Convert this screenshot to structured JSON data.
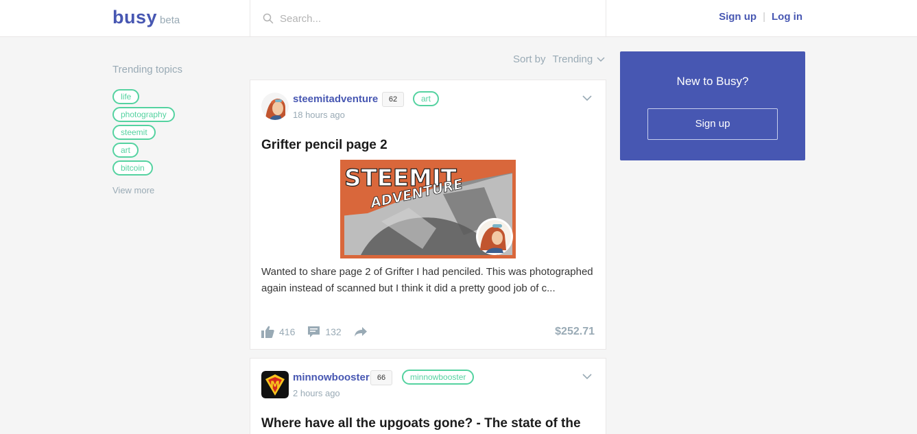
{
  "header": {
    "brand": "busy",
    "brand_tag": "beta",
    "search_placeholder": "Search...",
    "signup": "Sign up",
    "separator": "|",
    "login": "Log in"
  },
  "sidebar": {
    "title": "Trending topics",
    "tags": [
      "life",
      "photography",
      "steemit",
      "art",
      "bitcoin"
    ],
    "view_more": "View more"
  },
  "sort": {
    "label": "Sort by",
    "value": "Trending"
  },
  "posts": [
    {
      "author": "steemitadventure",
      "reputation": "62",
      "tag": "art",
      "time": "18 hours ago",
      "title": "Grifter pencil page 2",
      "excerpt": "Wanted to share page 2 of Grifter I had penciled. This was photographed again instead of scanned but I think it did a pretty good job of c...",
      "cover_text_1": "STEEMIT",
      "cover_text_2": "ADVENTURE",
      "likes": "416",
      "comments": "132",
      "payout": "$252.71"
    },
    {
      "author": "minnowbooster",
      "reputation": "66",
      "tag": "minnowbooster",
      "time": "2 hours ago",
      "title": "Where have all the upgoats gone? - The state of the",
      "avatar_letter": "M"
    }
  ],
  "signup_card": {
    "title": "New to Busy?",
    "button": "Sign up"
  },
  "colors": {
    "brand": "#4757b2",
    "tag": "#54d2a0",
    "muted": "#99aab5",
    "background": "#f5f5f5"
  }
}
